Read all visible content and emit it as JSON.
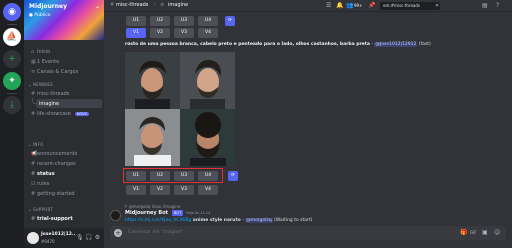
{
  "server": {
    "name": "Midjourney",
    "subtitle": "Público",
    "chevron": "⌄"
  },
  "rail": {
    "icons": [
      "discord-logo-icon",
      "midjourney-server-icon",
      "add-server-icon",
      "explore-icon",
      "download-icon"
    ]
  },
  "sidebar": {
    "top_items": [
      {
        "label": "Início",
        "icon": "home-icon"
      },
      {
        "label": "1 Evento",
        "icon": "calendar-icon"
      },
      {
        "label": "Canais & Cargos",
        "icon": "channels-icon"
      }
    ],
    "categories": {
      "newbies": "NEWBIES",
      "info": "INFO",
      "support": "SUPPORT"
    },
    "newbies_items": [
      {
        "label": "misc-threads"
      },
      {
        "label": "imagine",
        "active": true
      },
      {
        "label": "life-showcase",
        "badge": "NOVO"
      }
    ],
    "info_items": [
      {
        "label": "announcements"
      },
      {
        "label": "recent-changes"
      },
      {
        "label": "status",
        "bold": true
      },
      {
        "label": "rules"
      },
      {
        "label": "getting-started"
      }
    ],
    "support_items": [
      {
        "label": "trial-support",
        "bold": true
      }
    ]
  },
  "user": {
    "name": "Jose1012|12..",
    "tag": "#0470"
  },
  "topbar": {
    "channel": "misc-threads",
    "thread": "imagine",
    "member_count": "99+",
    "search_value": "em:#misc-threads"
  },
  "upscale_row_top": [
    "U1",
    "U2",
    "U3",
    "U4"
  ],
  "variation_row_top": [
    "V1",
    "V2",
    "V3",
    "V4"
  ],
  "prompt": {
    "text": "rosto de uma pessoa branca, cabelo preto e penteado para o lado, olhos castanhos, barba preta",
    "separator": " - ",
    "mention": "@Jose1012|12912",
    "suffix": " (fast)"
  },
  "upscale_row": [
    "U1",
    "U2",
    "U3",
    "U4"
  ],
  "variation_row": [
    "V1",
    "V2",
    "V3",
    "V4"
  ],
  "bot_message": {
    "reply_author": "@morgoliq",
    "reply_text": "Usou /imagine",
    "author": "Midjourney Bot",
    "bot_tag": "BOT",
    "time": "Hoje às 11:14",
    "link": "https://s.mj.run/XJeo_VCX6Bg",
    "text": "anime style naruto",
    "mention": "@morgolzq",
    "status": "(Waiting to start)"
  },
  "composer": {
    "placeholder": "Conversar em \"imagine\""
  },
  "colors": {
    "accent": "#5865f2",
    "highlight": "#e03232",
    "link": "#00a8fc"
  }
}
